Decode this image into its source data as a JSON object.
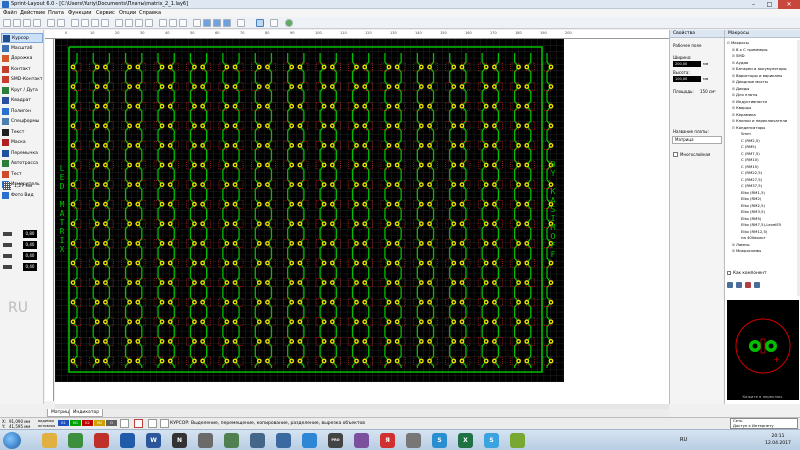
{
  "window": {
    "title": "Sprint-Layout 6.0 - [C:\\Users\\Yuriy\\Documents\\Платы\\matrix_2_1.lay6]",
    "controls": {
      "minimize": "–",
      "maximize": "□",
      "close": "✕"
    }
  },
  "menu": {
    "items": [
      "Файл",
      "Действие",
      "Плата",
      "Функции",
      "Сервис",
      "Опции",
      "Справка"
    ]
  },
  "toolbar": {
    "icons": [
      "new-file-icon",
      "open-icon",
      "save-icon",
      "print-icon",
      "undo-icon",
      "redo-icon",
      "cut-icon",
      "copy-icon",
      "paste-icon",
      "delete-icon",
      "duplicate-icon",
      "rotate-icon",
      "mirror-h-icon",
      "mirror-v-icon",
      "align-icon",
      "group-icon",
      "ungroup-icon",
      "zoom-icon",
      "zoom-in-icon",
      "zoom-out-icon",
      "zoom-fit-icon",
      "cursor-tool-icon",
      "pan-icon",
      "drc-icon",
      "photo-icon"
    ]
  },
  "tools": {
    "items": [
      {
        "label": "Курсор",
        "icon": "cursor-icon",
        "color": "#1d4f91",
        "active": true
      },
      {
        "label": "Масштаб",
        "icon": "magnifier-icon",
        "color": "#3b6fb6"
      },
      {
        "label": "Дорожка",
        "icon": "track-icon",
        "color": "#d45a2a"
      },
      {
        "label": "Контакт",
        "icon": "pad-icon",
        "color": "#c43c2c"
      },
      {
        "label": "SMD-Контакт",
        "icon": "smd-pad-icon",
        "color": "#c43c2c"
      },
      {
        "label": "Круг / Дуга",
        "icon": "circle-arc-icon",
        "color": "#2a7f3a"
      },
      {
        "label": "Квадрат",
        "icon": "square-icon",
        "color": "#2a4f9f"
      },
      {
        "label": "Полигон",
        "icon": "polygon-icon",
        "color": "#2a6fcf"
      },
      {
        "label": "Спецформы",
        "icon": "special-forms-icon",
        "color": "#4a7fb0"
      },
      {
        "label": "Текст",
        "icon": "text-icon",
        "color": "#202020"
      },
      {
        "label": "Маска",
        "icon": "mask-icon",
        "color": "#b02020"
      },
      {
        "label": "Перемычка",
        "icon": "jumper-icon",
        "color": "#2050a0"
      },
      {
        "label": "Автотрасса",
        "icon": "autoroute-icon",
        "color": "#2a7f3a"
      },
      {
        "label": "Тест",
        "icon": "test-icon",
        "color": "#cf4a2a"
      },
      {
        "label": "Измеритель",
        "icon": "ruler-icon",
        "color": "#2a6fcf"
      },
      {
        "label": "Фото Вид",
        "icon": "photo-view-icon",
        "color": "#2a6fcf"
      }
    ],
    "grid_size": "1,27 мм",
    "widths": [
      "0,80",
      "0,40",
      "0,40",
      "0,40"
    ],
    "language": "RU"
  },
  "ruler": {
    "top_ticks": [
      "0",
      "10",
      "20",
      "30",
      "40",
      "50",
      "60",
      "70",
      "80",
      "90",
      "100",
      "110",
      "120",
      "130",
      "140",
      "150",
      "160",
      "170",
      "180",
      "190",
      "200"
    ]
  },
  "board": {
    "text_left": "LED MATRIX",
    "text_right": "BY KASIMOFF",
    "columns": 30,
    "rows": 16,
    "colors": {
      "background": "#000000",
      "grid": "#ff3030",
      "track": "#00c000",
      "pad_ring": "#e8e000",
      "pad_hole": "#000000",
      "text": "#00c000"
    }
  },
  "tabs": {
    "items": [
      "Матрица",
      "Индикатор"
    ]
  },
  "properties": {
    "header": "Свойства",
    "section": "Рабочее поле",
    "width_label": "Ширина:",
    "width_value": "200,00",
    "height_label": "Высота:",
    "height_value": "100,00",
    "unit": "мм",
    "area_label": "Площадь:",
    "area_value": "150 см²",
    "name_label": "Название платы:",
    "name_value": "Матрица",
    "multilayer_label": "Многослойная"
  },
  "macros": {
    "header": "Макросы",
    "tree": [
      {
        "label": "Макросы",
        "level": 0,
        "toggle": "⊟"
      },
      {
        "label": "8 x С триммеры",
        "level": 1,
        "toggle": "⊞"
      },
      {
        "label": "SMD",
        "level": 1,
        "toggle": "⊞"
      },
      {
        "label": "Аудио",
        "level": 1,
        "toggle": "⊞"
      },
      {
        "label": "Батареи и аккумуляторы",
        "level": 1,
        "toggle": "⊞"
      },
      {
        "label": "Варисторы и варикапы",
        "level": 1,
        "toggle": "⊞"
      },
      {
        "label": "Диодные мосты",
        "level": 1,
        "toggle": "⊞"
      },
      {
        "label": "Диоды",
        "level": 1,
        "toggle": "⊞"
      },
      {
        "label": "Для платы",
        "level": 1,
        "toggle": "⊞"
      },
      {
        "label": "Индуктивности",
        "level": 1,
        "toggle": "⊞"
      },
      {
        "label": "Кварцы",
        "level": 1,
        "toggle": "⊞"
      },
      {
        "label": "Керамика",
        "level": 1,
        "toggle": "⊞"
      },
      {
        "label": "Кнопки и переключатели",
        "level": 1,
        "toggle": "⊞"
      },
      {
        "label": "Конденсаторы",
        "level": 1,
        "toggle": "⊟"
      },
      {
        "label": "Smm",
        "level": 2,
        "toggle": ""
      },
      {
        "label": "C (RM2,5)",
        "level": 2,
        "toggle": ""
      },
      {
        "label": "C (RM5)",
        "level": 2,
        "toggle": ""
      },
      {
        "label": "C (RM7,5)",
        "level": 2,
        "toggle": ""
      },
      {
        "label": "C (RM10)",
        "level": 2,
        "toggle": ""
      },
      {
        "label": "C (RM15)",
        "level": 2,
        "toggle": ""
      },
      {
        "label": "C (RM22,5)",
        "level": 2,
        "toggle": ""
      },
      {
        "label": "C (RM27,5)",
        "level": 2,
        "toggle": ""
      },
      {
        "label": "C (RM37,5)",
        "level": 2,
        "toggle": ""
      },
      {
        "label": "Elko (RM1,5)",
        "level": 2,
        "toggle": ""
      },
      {
        "label": "Elko (RM2)",
        "level": 2,
        "toggle": ""
      },
      {
        "label": "Elko (RM2,5)",
        "level": 2,
        "toggle": ""
      },
      {
        "label": "Elko (RM3,5)",
        "level": 2,
        "toggle": ""
      },
      {
        "label": "Elko (RM5)",
        "level": 2,
        "toggle": ""
      },
      {
        "label": "Elko (RM7,5)-LevelE5",
        "level": 2,
        "toggle": ""
      },
      {
        "label": "Elko (RM12,5)",
        "level": 2,
        "toggle": ""
      },
      {
        "label": "на 400вольт",
        "level": 2,
        "toggle": ""
      },
      {
        "label": "Лампы",
        "level": 1,
        "toggle": "⊞"
      },
      {
        "label": "Микросхемы",
        "level": 1,
        "toggle": "⊞"
      }
    ],
    "as_component_label": "Как компонент",
    "preview_label": "Кажите в переключ."
  },
  "status": {
    "x_label": "X:",
    "x_value": "91,090 мм",
    "y_label": "Y:",
    "y_value": "41,595 мм",
    "visible_label": "видимая",
    "active_label": "активная",
    "layers": [
      "K1",
      "M1",
      "K2",
      "M2",
      "O"
    ],
    "layer_colors": [
      "#2050c0",
      "#00a000",
      "#c00000",
      "#d0a000",
      "#606060"
    ],
    "hint": "КУРСОР: Выделение, перемещение, копирование, разделение, вырезка объектов"
  },
  "taskbar": {
    "apps": [
      {
        "icon": "explorer-icon",
        "text": "",
        "color": "#e0b040"
      },
      {
        "icon": "chrome-icon",
        "text": "",
        "color": "#3c8f3c"
      },
      {
        "icon": "opera-icon",
        "text": "",
        "color": "#c0302a"
      },
      {
        "icon": "outlook-icon",
        "text": "",
        "color": "#1f5ba8"
      },
      {
        "icon": "word-icon",
        "text": "W",
        "color": "#2b579a"
      },
      {
        "icon": "nanocad-icon",
        "text": "N",
        "color": "#333333"
      },
      {
        "icon": "app-icon",
        "text": "",
        "color": "#6a6a6a"
      },
      {
        "icon": "calc-icon",
        "text": "",
        "color": "#508050"
      },
      {
        "icon": "mirc-icon",
        "text": "",
        "color": "#446688"
      },
      {
        "icon": "image-icon",
        "text": "",
        "color": "#3a6aa0"
      },
      {
        "icon": "skype-icon",
        "text": "",
        "color": "#2e87d4"
      },
      {
        "icon": "proafc-icon",
        "text": "PRO AFC",
        "color": "#444444"
      },
      {
        "icon": "viber-icon",
        "text": "",
        "color": "#7b519d"
      },
      {
        "icon": "yandex-icon",
        "text": "Я",
        "color": "#d03030"
      },
      {
        "icon": "tool-icon",
        "text": "",
        "color": "#777777"
      },
      {
        "icon": "sprint-icon",
        "text": "S",
        "color": "#2a8fd0"
      },
      {
        "icon": "excel-icon",
        "text": "X",
        "color": "#1f7244"
      },
      {
        "icon": "sprint-layout-icon",
        "text": "S",
        "color": "#3aa3e0"
      },
      {
        "icon": "android-icon",
        "text": "",
        "color": "#78a832"
      }
    ],
    "tray_lang": "RU",
    "time": "20:11",
    "date": "12.04.2017",
    "tooltip_line1": "Сеть",
    "tooltip_line2": "Доступ к Интернету"
  }
}
